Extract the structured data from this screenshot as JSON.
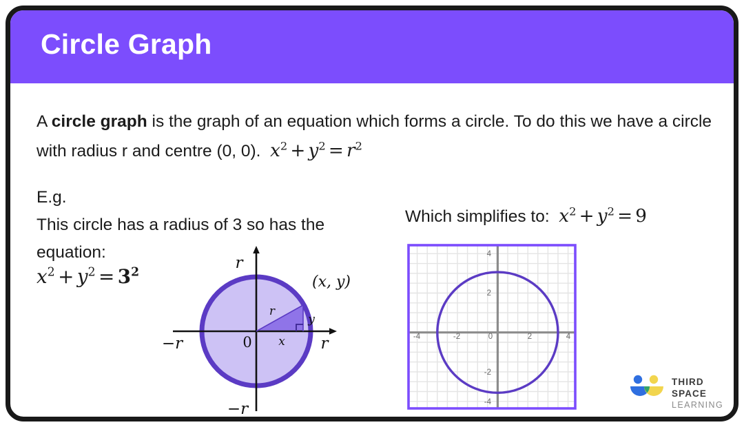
{
  "header": {
    "title": "Circle Graph",
    "background_color": "#7c4dfd",
    "text_color": "#ffffff"
  },
  "intro": {
    "part1": "A ",
    "bold": "circle graph",
    "part2": " is the graph of an equation which forms a circle. To do this we have a circle with radius r and centre (0, 0).  ",
    "formula": {
      "x": "x",
      "x_exp": "2",
      "plus": "+",
      "y": "y",
      "y_exp": "2",
      "equals": "=",
      "r": "r",
      "r_exp": "2"
    }
  },
  "example": {
    "eg_label": "E.g.",
    "sentence": "This circle has a radius of 3 so has the equation:",
    "equation": {
      "x": "x",
      "x_exp": "2",
      "plus": "+",
      "y": "y",
      "y_exp": "2",
      "equals": "=",
      "value": "3",
      "value_exp": "2"
    }
  },
  "simplifies": {
    "label": "Which simplifies to:  ",
    "equation": {
      "x": "x",
      "x_exp": "2",
      "plus": "+",
      "y": "y",
      "y_exp": "2",
      "equals": "=",
      "value": "9"
    }
  },
  "unit_circle": {
    "labels": {
      "top": "r",
      "bottom": "−r",
      "left": "−r",
      "right": "r",
      "origin": "0",
      "point": "(x, y)",
      "hypotenuse": "r",
      "base": "x",
      "height": "y"
    },
    "colors": {
      "fill": "#cdc2f5",
      "stroke": "#5b3bc4",
      "triangle_fill": "#8f74e8",
      "axis": "#111111"
    },
    "radius_units": "r"
  },
  "chart_data": {
    "type": "line",
    "title": "",
    "xlabel": "",
    "ylabel": "",
    "xlim": [
      -4.6,
      4.6
    ],
    "ylim": [
      -4.6,
      4.6
    ],
    "xticks": [
      "-4",
      "-2",
      "0",
      "2",
      "4"
    ],
    "yticks": [
      "4",
      "2",
      "0",
      "-2",
      "-4"
    ],
    "xtick_values": [
      -4,
      -2,
      0,
      2,
      4
    ],
    "ytick_values": [
      4,
      2,
      0,
      -2,
      -4
    ],
    "grid": true,
    "grid_minor_step": 0.5,
    "legend": "none",
    "series": [
      {
        "name": "x^2 + y^2 = 9",
        "type": "circle",
        "center": [
          0,
          0
        ],
        "radius": 3,
        "color": "#5b3bc4"
      }
    ],
    "colors": {
      "border": "#7c4dfd",
      "axis": "#8c8c8c",
      "grid": "#e4e4e4",
      "tick_label": "#6a6a6a"
    }
  },
  "logo": {
    "line1": "THIRD SPACE",
    "line2": "LEARNING",
    "colors": {
      "blue": "#2f6fe0",
      "blue_dot": "#2f6fe0",
      "yellow": "#f2d54e",
      "green": "#32a36b"
    }
  }
}
